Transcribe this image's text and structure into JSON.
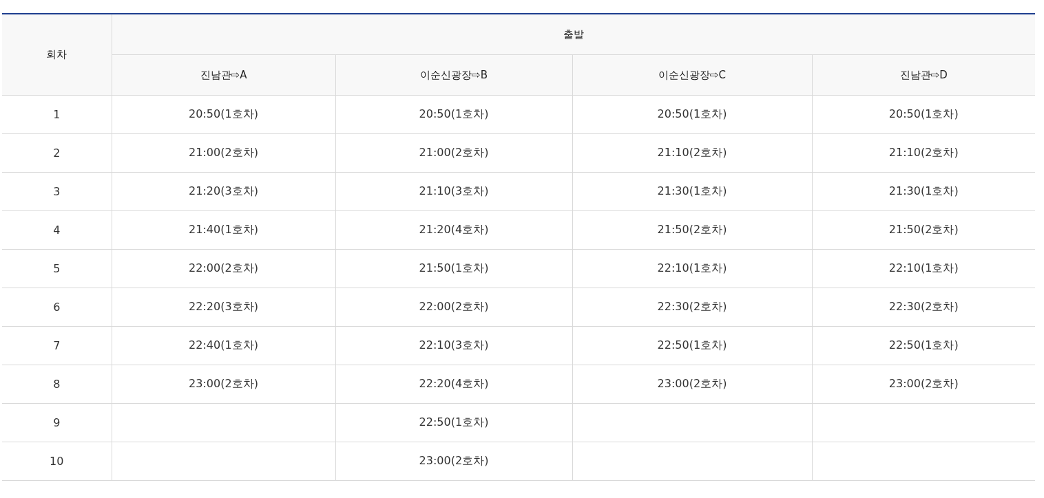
{
  "table": {
    "corner_header": "회차",
    "group_header": "출발",
    "columns": [
      "진남관⇨A",
      "이순신광장⇨B",
      "이순신광장⇨C",
      "진남관⇨D"
    ],
    "rows": [
      {
        "round": "1",
        "cells": [
          "20:50(1호차)",
          "20:50(1호차)",
          "20:50(1호차)",
          "20:50(1호차)"
        ]
      },
      {
        "round": "2",
        "cells": [
          "21:00(2호차)",
          "21:00(2호차)",
          "21:10(2호차)",
          "21:10(2호차)"
        ]
      },
      {
        "round": "3",
        "cells": [
          "21:20(3호차)",
          "21:10(3호차)",
          "21:30(1호차)",
          "21:30(1호차)"
        ]
      },
      {
        "round": "4",
        "cells": [
          "21:40(1호차)",
          "21:20(4호차)",
          "21:50(2호차)",
          "21:50(2호차)"
        ]
      },
      {
        "round": "5",
        "cells": [
          "22:00(2호차)",
          "21:50(1호차)",
          "22:10(1호차)",
          "22:10(1호차)"
        ]
      },
      {
        "round": "6",
        "cells": [
          "22:20(3호차)",
          "22:00(2호차)",
          "22:30(2호차)",
          "22:30(2호차)"
        ]
      },
      {
        "round": "7",
        "cells": [
          "22:40(1호차)",
          "22:10(3호차)",
          "22:50(1호차)",
          "22:50(1호차)"
        ]
      },
      {
        "round": "8",
        "cells": [
          "23:00(2호차)",
          "22:20(4호차)",
          "23:00(2호차)",
          "23:00(2호차)"
        ]
      },
      {
        "round": "9",
        "cells": [
          null,
          "22:50(1호차)",
          null,
          null
        ]
      },
      {
        "round": "10",
        "cells": [
          null,
          "23:00(2호차)",
          null,
          null
        ]
      }
    ]
  }
}
